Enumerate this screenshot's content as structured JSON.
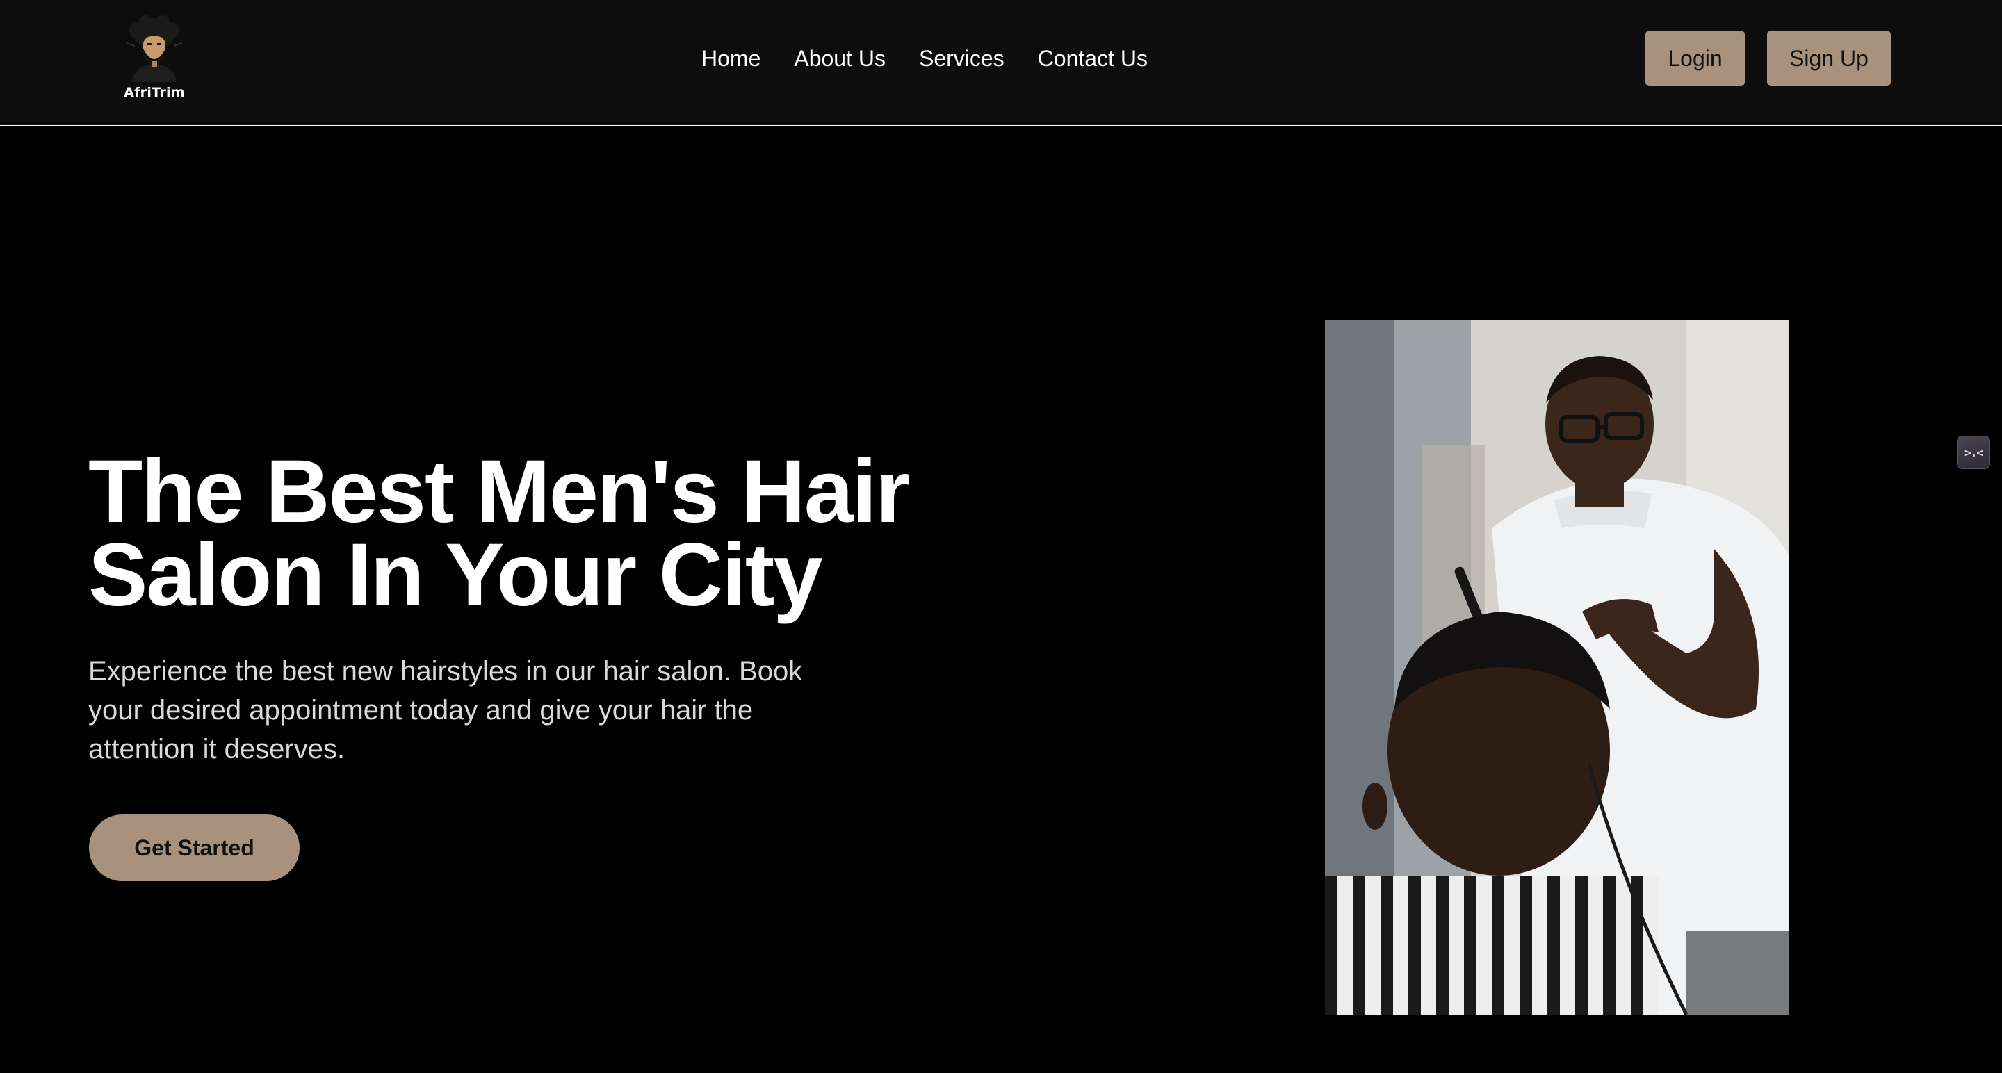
{
  "brand": {
    "name": "AfriTrim",
    "logo_icon": "barber-avatar-icon"
  },
  "nav": {
    "items": [
      {
        "label": "Home"
      },
      {
        "label": "About Us"
      },
      {
        "label": "Services"
      },
      {
        "label": "Contact Us"
      }
    ]
  },
  "auth": {
    "login_label": "Login",
    "signup_label": "Sign Up"
  },
  "hero": {
    "title_line1": "The Best Men's Hair",
    "title_line2": "Salon In Your City",
    "description": "Experience the best new hairstyles in our hair salon. Book your desired appointment today and give your hair the attention it deserves.",
    "cta_label": "Get Started",
    "image_icon": "barber-cutting-hair-photo"
  },
  "side_widget": {
    "glyph": ">.<",
    "icon": "devtools-widget-icon"
  },
  "colors": {
    "header_bg": "#0d0d0d",
    "page_bg": "#000000",
    "accent": "#a8927e",
    "text_primary": "#ffffff",
    "text_secondary": "#d9d9d9"
  }
}
